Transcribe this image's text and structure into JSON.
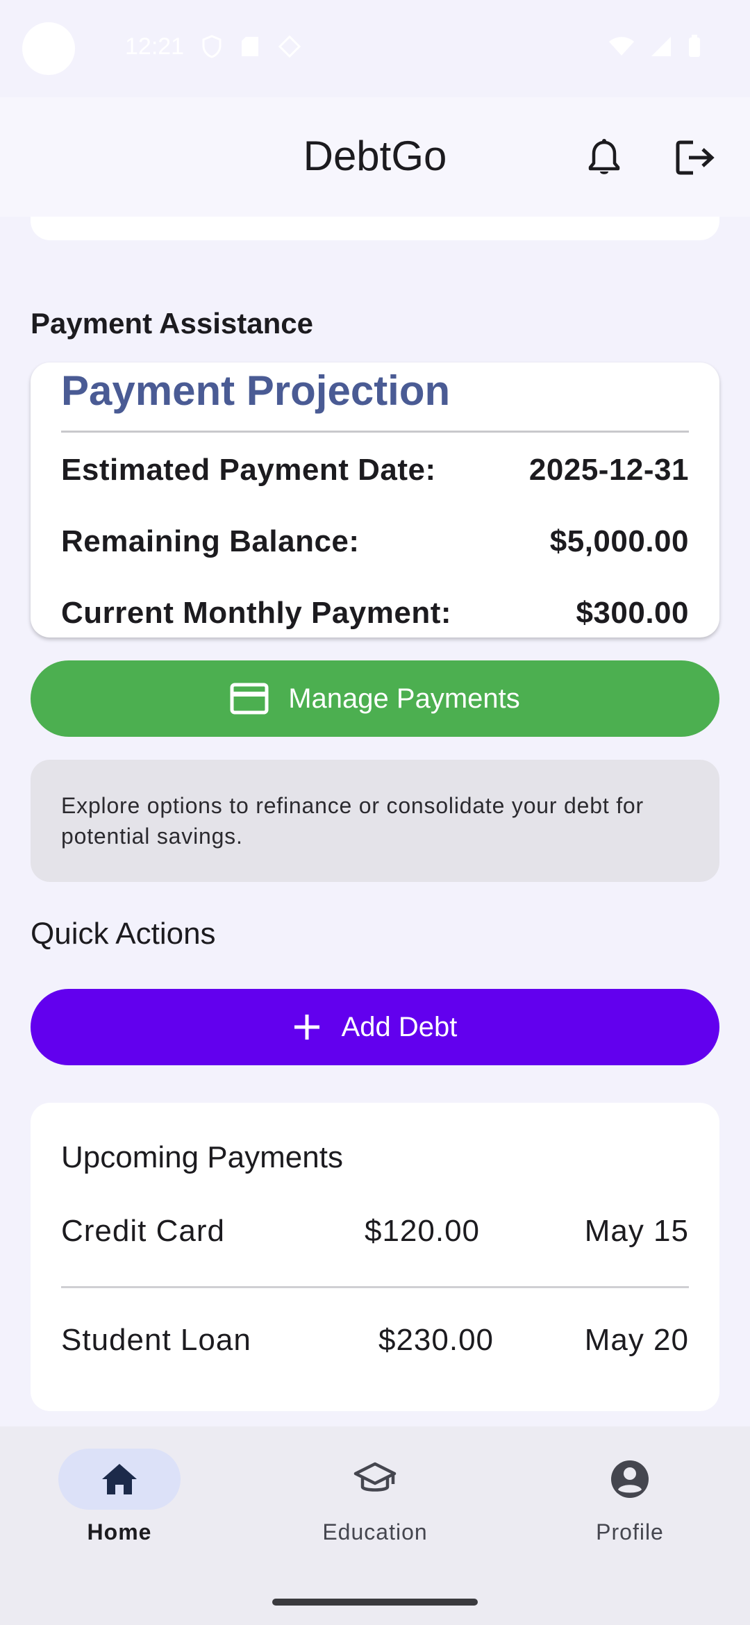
{
  "status_bar": {
    "time": "12:21"
  },
  "app_bar": {
    "title": "DebtGo"
  },
  "payment_assistance": {
    "section_title": "Payment Assistance",
    "projection": {
      "title": "Payment Projection",
      "rows": [
        {
          "label": "Estimated Payment Date:",
          "value": "2025-12-31"
        },
        {
          "label": "Remaining Balance:",
          "value": "$5,000.00"
        },
        {
          "label": "Current Monthly Payment:",
          "value": "$300.00"
        }
      ]
    },
    "manage_button_label": "Manage Payments",
    "info_text": "Explore options to refinance or consolidate your debt for potential savings."
  },
  "quick_actions": {
    "section_title": "Quick Actions",
    "add_debt_label": "Add Debt"
  },
  "upcoming_payments": {
    "title": "Upcoming Payments",
    "items": [
      {
        "name": "Credit Card",
        "amount": "$120.00",
        "date": "May 15"
      },
      {
        "name": "Student Loan",
        "amount": "$230.00",
        "date": "May 20"
      }
    ]
  },
  "bottom_nav": {
    "items": [
      {
        "label": "Home",
        "icon": "home-icon",
        "active": true
      },
      {
        "label": "Education",
        "icon": "school-icon",
        "active": false
      },
      {
        "label": "Profile",
        "icon": "account-circle-icon",
        "active": false
      }
    ]
  },
  "colors": {
    "background": "#f3f2fc",
    "projection_title": "#4a5b94",
    "manage_button": "#4caf50",
    "add_debt_button": "#6200ee",
    "info_box": "#e4e3e9",
    "nav_active_pill": "#dce1f8"
  }
}
